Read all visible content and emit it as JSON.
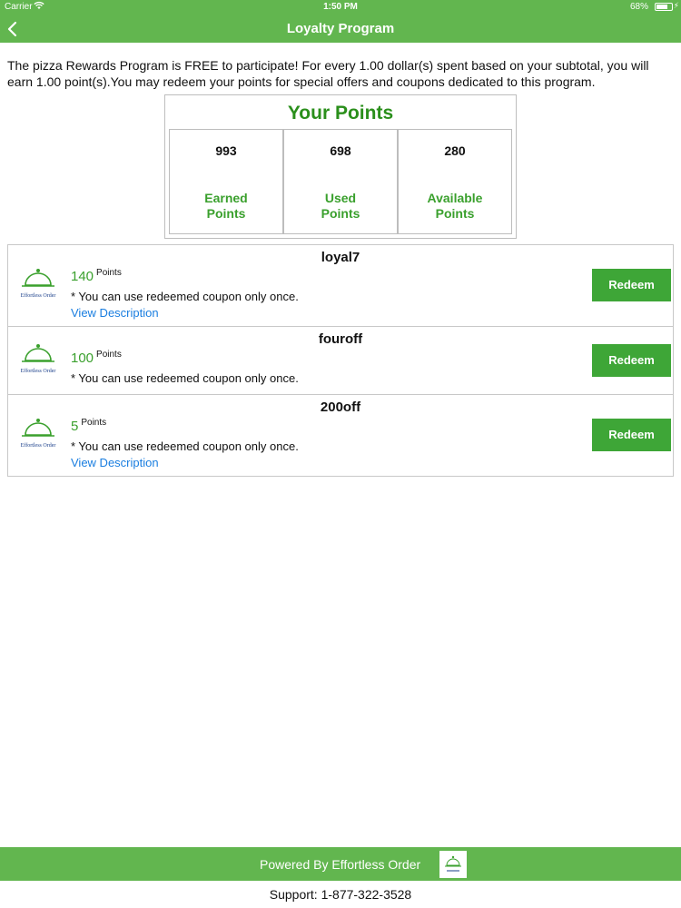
{
  "status_bar": {
    "carrier": "Carrier",
    "time": "1:50 PM",
    "battery": "68%"
  },
  "nav": {
    "title": "Loyalty Program",
    "back_icon": "chevron-left-icon"
  },
  "intro": "The pizza Rewards Program is FREE to participate! For every 1.00 dollar(s) spent based on your subtotal, you will earn 1.00 point(s).You may redeem your points for special offers and coupons dedicated to this program.",
  "points": {
    "title": "Your Points",
    "earned": {
      "value": "993",
      "label": "Earned\nPoints"
    },
    "used": {
      "value": "698",
      "label": "Used\nPoints"
    },
    "available": {
      "value": "280",
      "label": "Available\nPoints"
    }
  },
  "coupons": [
    {
      "name": "loyal7",
      "points": "140",
      "points_unit": "Points",
      "note": "* You can use redeemed coupon only once.",
      "link": "View Description",
      "button": "Redeem",
      "logo_text": "Effortless Order"
    },
    {
      "name": "fouroff",
      "points": "100",
      "points_unit": "Points",
      "note": "* You can use redeemed coupon only once.",
      "button": "Redeem",
      "logo_text": "Effortless Order"
    },
    {
      "name": "200off",
      "points": "5",
      "points_unit": "Points",
      "note": "* You can use redeemed coupon only once.",
      "link": "View Description",
      "button": "Redeem",
      "logo_text": "Effortless Order"
    }
  ],
  "footer": {
    "powered": "Powered By Effortless Order",
    "support": "Support: 1-877-322-3528"
  },
  "colors": {
    "brand_green": "#62b64f",
    "button_green": "#3ea637",
    "text_green": "#3aa02d",
    "link_blue": "#1a7ee0"
  }
}
